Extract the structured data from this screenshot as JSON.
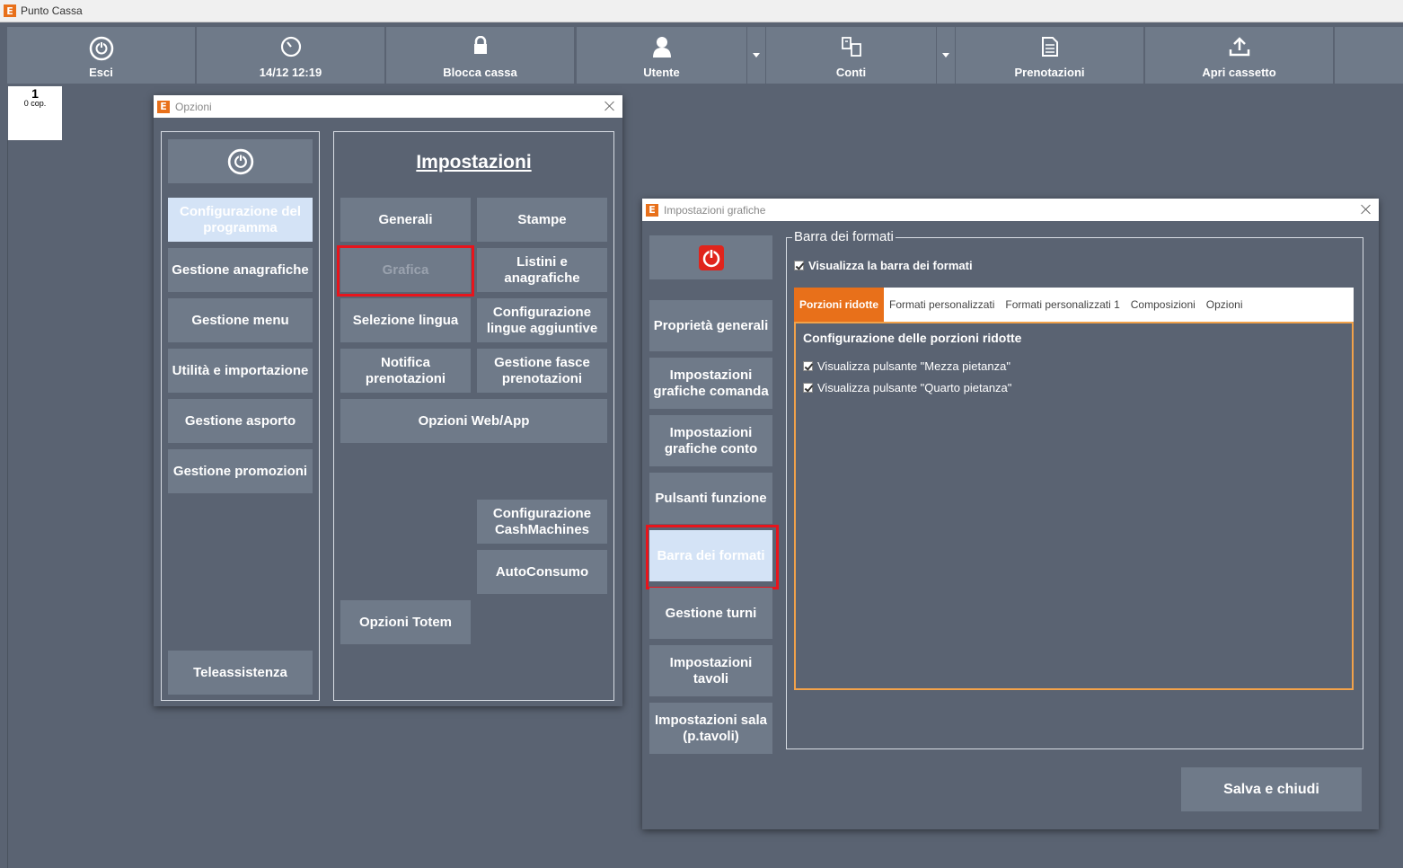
{
  "app": {
    "title": "Punto Cassa",
    "logo_letter": "E"
  },
  "toolbar": {
    "exit": "Esci",
    "datetime": "14/12 12:19",
    "lock": "Blocca cassa",
    "user": "Utente",
    "accounts": "Conti",
    "bookings": "Prenotazioni",
    "drawer": "Apri cassetto"
  },
  "table_tile": {
    "number": "1",
    "covers": "0 cop."
  },
  "options_window": {
    "title": "Opzioni",
    "left_buttons": {
      "program_config": "Configurazione del programma",
      "registry": "Gestione anagrafiche",
      "menu": "Gestione menu",
      "utilities": "Utilità e importazione",
      "takeaway": "Gestione asporto",
      "promotions": "Gestione promozioni",
      "remote_support": "Teleassistenza"
    },
    "settings_heading": "Impostazioni",
    "settings_buttons": {
      "general": "Generali",
      "prints": "Stampe",
      "graphics": "Grafica",
      "price_lists": "Listini e anagrafiche",
      "language": "Selezione lingua",
      "extra_languages": "Configurazione lingue aggiuntive",
      "booking_notify": "Notifica prenotazioni",
      "booking_slots": "Gestione fasce prenotazioni",
      "web_app": "Opzioni Web/App",
      "cashmachines": "Configurazione CashMachines",
      "self_consumption": "AutoConsumo",
      "totem": "Opzioni Totem"
    }
  },
  "graphics_window": {
    "title": "Impostazioni grafiche",
    "side_buttons": {
      "general_props": "Proprietà generali",
      "order_graphics": "Impostazioni grafiche comanda",
      "bill_graphics": "Impostazioni grafiche conto",
      "function_buttons": "Pulsanti funzione",
      "format_bar": "Barra dei formati",
      "shifts": "Gestione turni",
      "tables": "Impostazioni tavoli",
      "room": "Impostazioni sala (p.tavoli)"
    },
    "group_title": "Barra dei formati",
    "show_bar_checkbox": "Visualizza la barra dei formati",
    "tabs": [
      "Porzioni ridotte",
      "Formati personalizzati",
      "Formati personalizzati 1",
      "Composizioni",
      "Opzioni"
    ],
    "section_title": "Configurazione delle porzioni ridotte",
    "half_portion": "Visualizza pulsante \"Mezza pietanza\"",
    "quarter_portion": "Visualizza pulsante \"Quarto pietanza\"",
    "save_close": "Salva e chiudi"
  },
  "colors": {
    "accent": "#e8701a",
    "highlight": "#e8141c",
    "button": "#6f7a89",
    "background": "#5a6372"
  }
}
